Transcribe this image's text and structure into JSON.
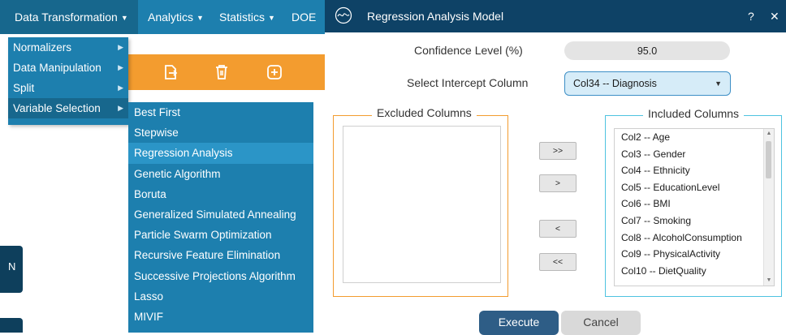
{
  "menubar": {
    "items": [
      {
        "label": "Data Transformation",
        "caret": "▼"
      },
      {
        "label": "Analytics",
        "caret": "▼"
      },
      {
        "label": "Statistics",
        "caret": "▼"
      },
      {
        "label": "DOE",
        "caret": ""
      }
    ]
  },
  "dropdown": {
    "items": [
      {
        "label": "Normalizers",
        "arrow": "▶"
      },
      {
        "label": "Data Manipulation",
        "arrow": "▶"
      },
      {
        "label": "Split",
        "arrow": "▶"
      },
      {
        "label": "Variable Selection",
        "arrow": "▶"
      }
    ]
  },
  "submenu": {
    "items": [
      "Best First",
      "Stepwise",
      "Regression Analysis",
      "Genetic Algorithm",
      "Boruta",
      "Generalized Simulated Annealing",
      "Particle Swarm Optimization",
      "Recursive Feature Elimination",
      "Successive Projections Algorithm",
      "Lasso",
      "MIVIF"
    ],
    "active": "Regression Analysis"
  },
  "toolbar": {
    "icons": [
      "export-icon",
      "trash-icon",
      "add-icon"
    ],
    "accent": "#f39c2f"
  },
  "side_tab": {
    "label": "N"
  },
  "dialog": {
    "title": "Regression Analysis Model",
    "help_label": "?",
    "close_label": "✕",
    "confidence_label": "Confidence Level (%)",
    "confidence_value": "95.0",
    "intercept_label": "Select Intercept Column",
    "intercept_value": "Col34 -- Diagnosis",
    "excluded_title": "Excluded Columns",
    "included_title": "Included Columns",
    "excluded_items": [],
    "included_items": [
      "Col2 -- Age",
      "Col3 -- Gender",
      "Col4 -- Ethnicity",
      "Col5 -- EducationLevel",
      "Col6 -- BMI",
      "Col7 -- Smoking",
      "Col8 -- AlcoholConsumption",
      "Col9 -- PhysicalActivity",
      "Col10 -- DietQuality"
    ],
    "move_all_right": ">>",
    "move_right": ">",
    "move_left": "<",
    "move_all_left": "<<",
    "execute_label": "Execute",
    "cancel_label": "Cancel",
    "colors": {
      "titlebar": "#0e4266",
      "excluded_border": "#f39c2f",
      "included_border": "#4ec3e0",
      "execute": "#2e5d86"
    }
  }
}
